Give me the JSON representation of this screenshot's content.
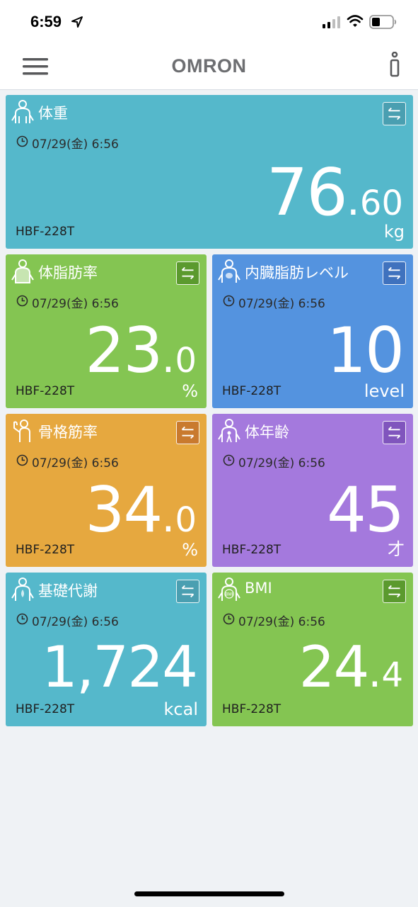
{
  "status": {
    "time": "6:59"
  },
  "header": {
    "brand": "OMRON"
  },
  "cards": {
    "weight": {
      "title": "体重",
      "date": "07/29(金) 6:56",
      "int": "76",
      "dot": ".",
      "dec": "60",
      "unit": "kg",
      "device": "HBF-228T",
      "color": "#55b8cb"
    },
    "fat": {
      "title": "体脂肪率",
      "date": "07/29(金) 6:56",
      "int": "23",
      "dot": ".",
      "dec": "0",
      "unit": "%",
      "device": "HBF-228T",
      "color": "#84c552"
    },
    "visceral": {
      "title": "内臓脂肪レベル",
      "date": "07/29(金) 6:56",
      "int": "10",
      "unit": "level",
      "device": "HBF-228T",
      "color": "#5493df"
    },
    "muscle": {
      "title": "骨格筋率",
      "date": "07/29(金) 6:56",
      "int": "34",
      "dot": ".",
      "dec": "0",
      "unit": "%",
      "device": "HBF-228T",
      "color": "#e6a83f"
    },
    "age": {
      "title": "体年齢",
      "date": "07/29(金) 6:56",
      "int": "45",
      "unit": "才",
      "device": "HBF-228T",
      "color": "#a479dd"
    },
    "bmr": {
      "title": "基礎代謝",
      "date": "07/29(金) 6:56",
      "int": "1,724",
      "unit": "kcal",
      "device": "HBF-228T",
      "color": "#55b8cb"
    },
    "bmi": {
      "title": "BMI",
      "date": "07/29(金) 6:56",
      "int": "24",
      "dot": ".",
      "dec": "4",
      "device": "HBF-228T",
      "color": "#84c552",
      "icon_text": "BMI"
    }
  },
  "icons": {
    "menu": "hamburger-menu-icon",
    "info": "info-icon",
    "swap": "swap-arrows-icon",
    "clock": "clock-icon"
  }
}
